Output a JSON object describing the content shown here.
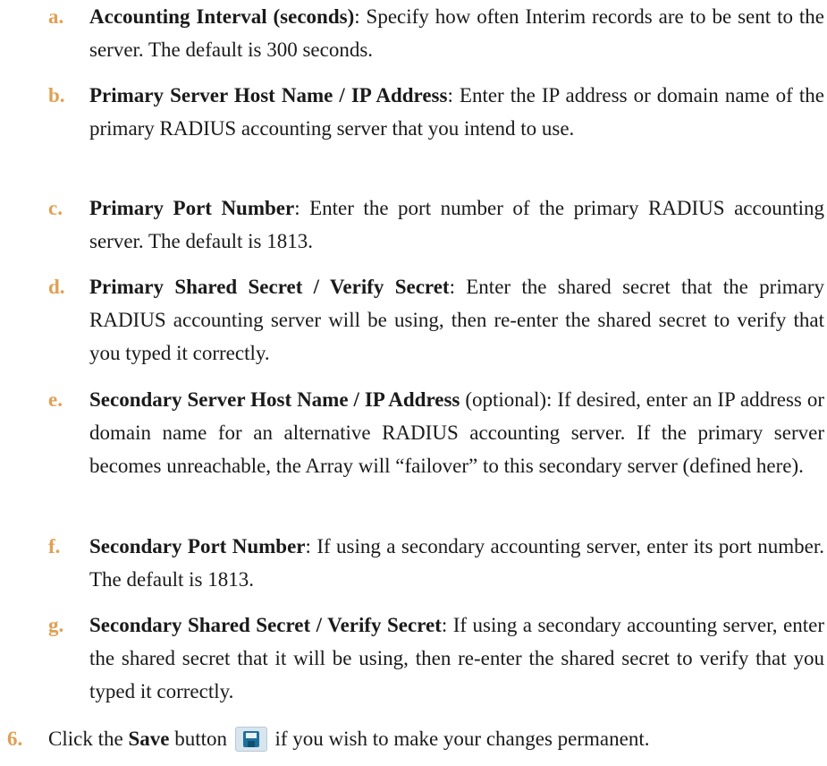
{
  "list_items": [
    {
      "marker": "a.",
      "term": "Accounting Interval (seconds)",
      "text": ": Specify how often Interim records are to be sent to the server. The default is 300 seconds."
    },
    {
      "marker": "b.",
      "term": "Primary Server Host Name / IP Address",
      "text": ": Enter the IP address or domain name of the primary RADIUS accounting server that you intend to use."
    },
    {
      "marker": "c.",
      "term": "Primary Port Number",
      "text": ": Enter the port number of the primary RADIUS accounting server. The default is 1813."
    },
    {
      "marker": "d.",
      "term": "Primary Shared Secret / Verify Secret",
      "text": ": Enter the shared secret that the primary RADIUS accounting server will be using, then re-enter the shared secret to verify that you typed it correctly."
    },
    {
      "marker": "e.",
      "term": "Secondary Server Host Name / IP Address",
      "text": " (optional): If desired, enter an IP address or domain name for an alternative RADIUS accounting server. If the primary server becomes unreachable, the Array will “failover” to this secondary server (defined here)."
    },
    {
      "marker": "f.",
      "term": "Secondary Port Number",
      "text": ": If using a secondary accounting server, enter its port number. The default is 1813."
    },
    {
      "marker": "g.",
      "term": "Secondary Shared Secret / Verify Secret",
      "text": ": If using a secondary accounting server, enter the shared secret that it will be using, then re-enter the shared secret to verify that you typed it correctly."
    }
  ],
  "step6": {
    "marker": "6.",
    "prefix": "Click the ",
    "term": "Save",
    "middle": " button",
    "suffix": " if you wish to make your changes permanent.",
    "icon": "save-icon"
  },
  "colors": {
    "marker": "#e0a053",
    "text": "#1a1a1a",
    "icon_background": "#d8e4ee",
    "icon_accent": "#1e6f9a"
  }
}
